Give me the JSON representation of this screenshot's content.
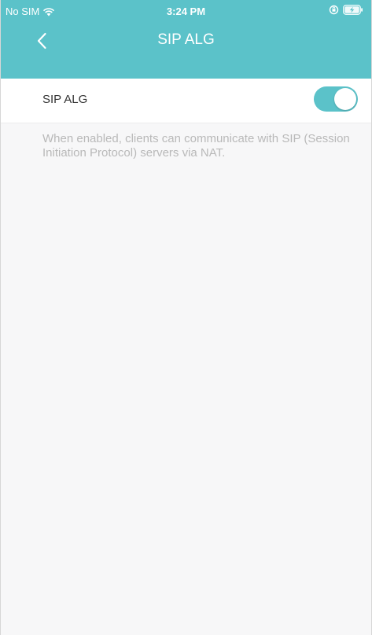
{
  "status_bar": {
    "carrier": "No SIM",
    "time": "3:24 PM",
    "icons": [
      "wifi-icon",
      "orientation-lock-icon",
      "battery-charging-icon"
    ]
  },
  "nav": {
    "title": "SIP ALG",
    "back_icon": "chevron-left-icon"
  },
  "setting": {
    "label": "SIP ALG",
    "enabled": true,
    "description": "When enabled, clients can communicate with SIP (Session Initiation Protocol) servers via NAT."
  },
  "colors": {
    "accent": "#5bc2c9",
    "background": "#f7f7f8",
    "description_text": "#b9b9b9"
  }
}
